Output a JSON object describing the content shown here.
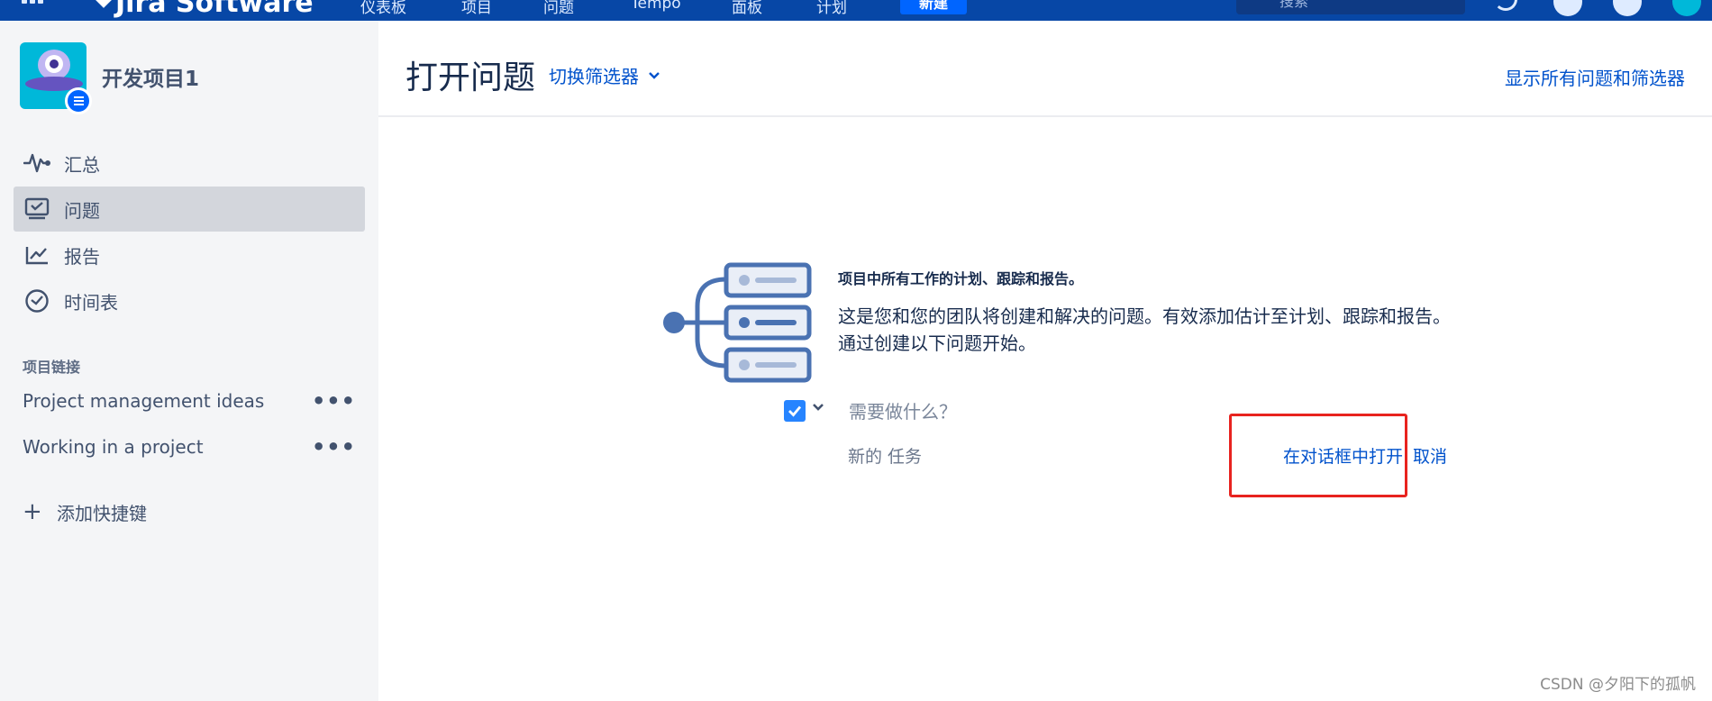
{
  "topbar": {
    "logo_text": "Jira Software",
    "nav": [
      "仪表板",
      "项目",
      "问题",
      "Tempo",
      "面板",
      "计划"
    ],
    "create_label": "新建",
    "search_placeholder": "搜索"
  },
  "project": {
    "name": "开发项目1"
  },
  "sidebar": {
    "items": [
      {
        "label": "汇总",
        "icon": "pulse-icon",
        "active": false
      },
      {
        "label": "问题",
        "icon": "issues-icon",
        "active": true
      },
      {
        "label": "报告",
        "icon": "reports-icon",
        "active": false
      },
      {
        "label": "时间表",
        "icon": "clock-icon",
        "active": false
      }
    ],
    "section_title": "项目链接",
    "links": [
      {
        "label": "Project management ideas"
      },
      {
        "label": "Working in a project"
      }
    ],
    "add_shortcut": "添加快捷键"
  },
  "main": {
    "title": "打开问题",
    "switch_filter": "切换筛选器",
    "show_all": "显示所有问题和筛选器",
    "empty_state": {
      "heading": "项目中所有工作的计划、跟踪和报告。",
      "description": "这是您和您的团队将创建和解决的问题。有效添加估计至计划、跟踪和报告。通过创建以下问题开始。"
    },
    "create_form": {
      "placeholder": "需要做什么？",
      "issue_type": "新的 任务",
      "open_in_dialog": "在对话框中打开",
      "cancel": "取消"
    }
  },
  "watermark": "CSDN @夕阳下的孤帆",
  "colors": {
    "topbar": "#0747a6",
    "link": "#0052cc",
    "highlight": "#e8231f",
    "sidebar_bg": "#f4f5f7"
  }
}
